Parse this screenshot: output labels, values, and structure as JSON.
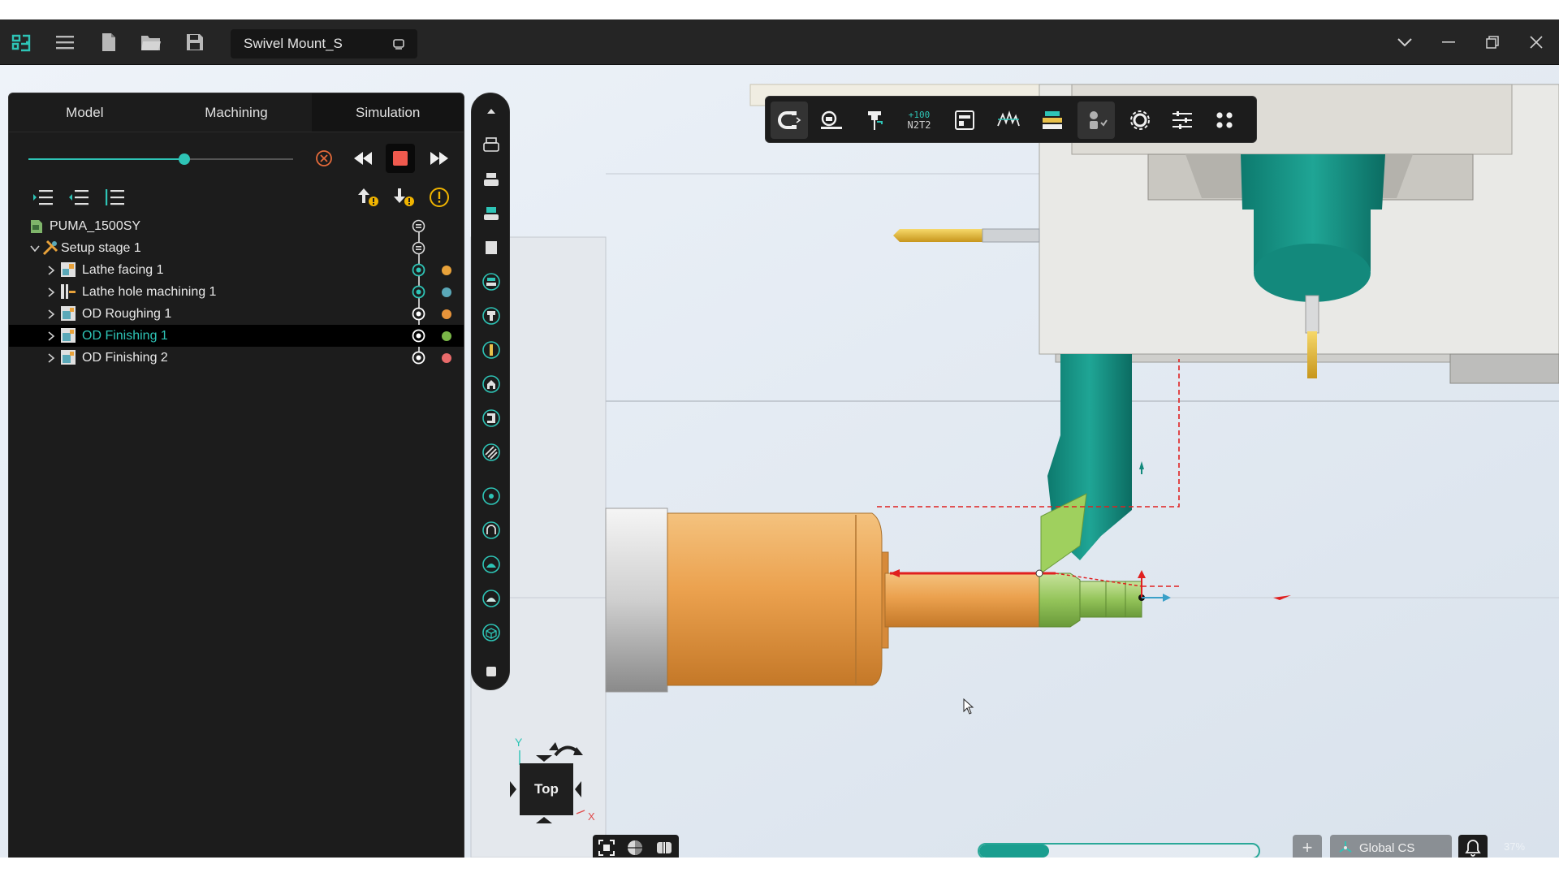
{
  "app": {
    "document_title": "Swivel Mount_S"
  },
  "panel": {
    "tabs": [
      {
        "label": "Model"
      },
      {
        "label": "Machining"
      },
      {
        "label": "Simulation"
      }
    ],
    "active_tab": "Simulation",
    "simulation": {
      "progress_fraction": 0.59
    },
    "tree": [
      {
        "label": "PUMA_1500SY",
        "depth": 0,
        "expandable": false,
        "dot_color": null
      },
      {
        "label": "Setup stage 1",
        "depth": 0,
        "expandable": true,
        "expanded": true,
        "dot_color": null
      },
      {
        "label": "Lathe facing 1",
        "depth": 1,
        "expandable": true,
        "dot_color": "#e8a23a",
        "state": "teal"
      },
      {
        "label": "Lathe hole machining 1",
        "depth": 1,
        "expandable": true,
        "dot_color": "#5aa8b8",
        "state": "teal"
      },
      {
        "label": "OD Roughing 1",
        "depth": 1,
        "expandable": true,
        "dot_color": "#e8943a",
        "state": "white"
      },
      {
        "label": "OD Finishing 1",
        "depth": 1,
        "expandable": true,
        "dot_color": "#7ab648",
        "state": "white",
        "selected": true
      },
      {
        "label": "OD Finishing 2",
        "depth": 1,
        "expandable": true,
        "dot_color": "#e86a6a",
        "state": "white"
      }
    ]
  },
  "toolbar": {
    "counter_icon_top": "+100",
    "counter_icon_bottom": "N2T2"
  },
  "viewcube": {
    "face_label": "Top",
    "axis_y": "Y",
    "axis_x": "X"
  },
  "statusbar": {
    "plus_label": "+",
    "coordinate_system": "Global CS",
    "simulation_progress": 0.25,
    "zoom": "37%"
  },
  "colors": {
    "accent": "#2ec4b6",
    "part_orange": "#e8a04a",
    "tool_teal": "#1a9e8f",
    "toolpath_red": "#e02020",
    "stock_green": "#8cc050"
  }
}
